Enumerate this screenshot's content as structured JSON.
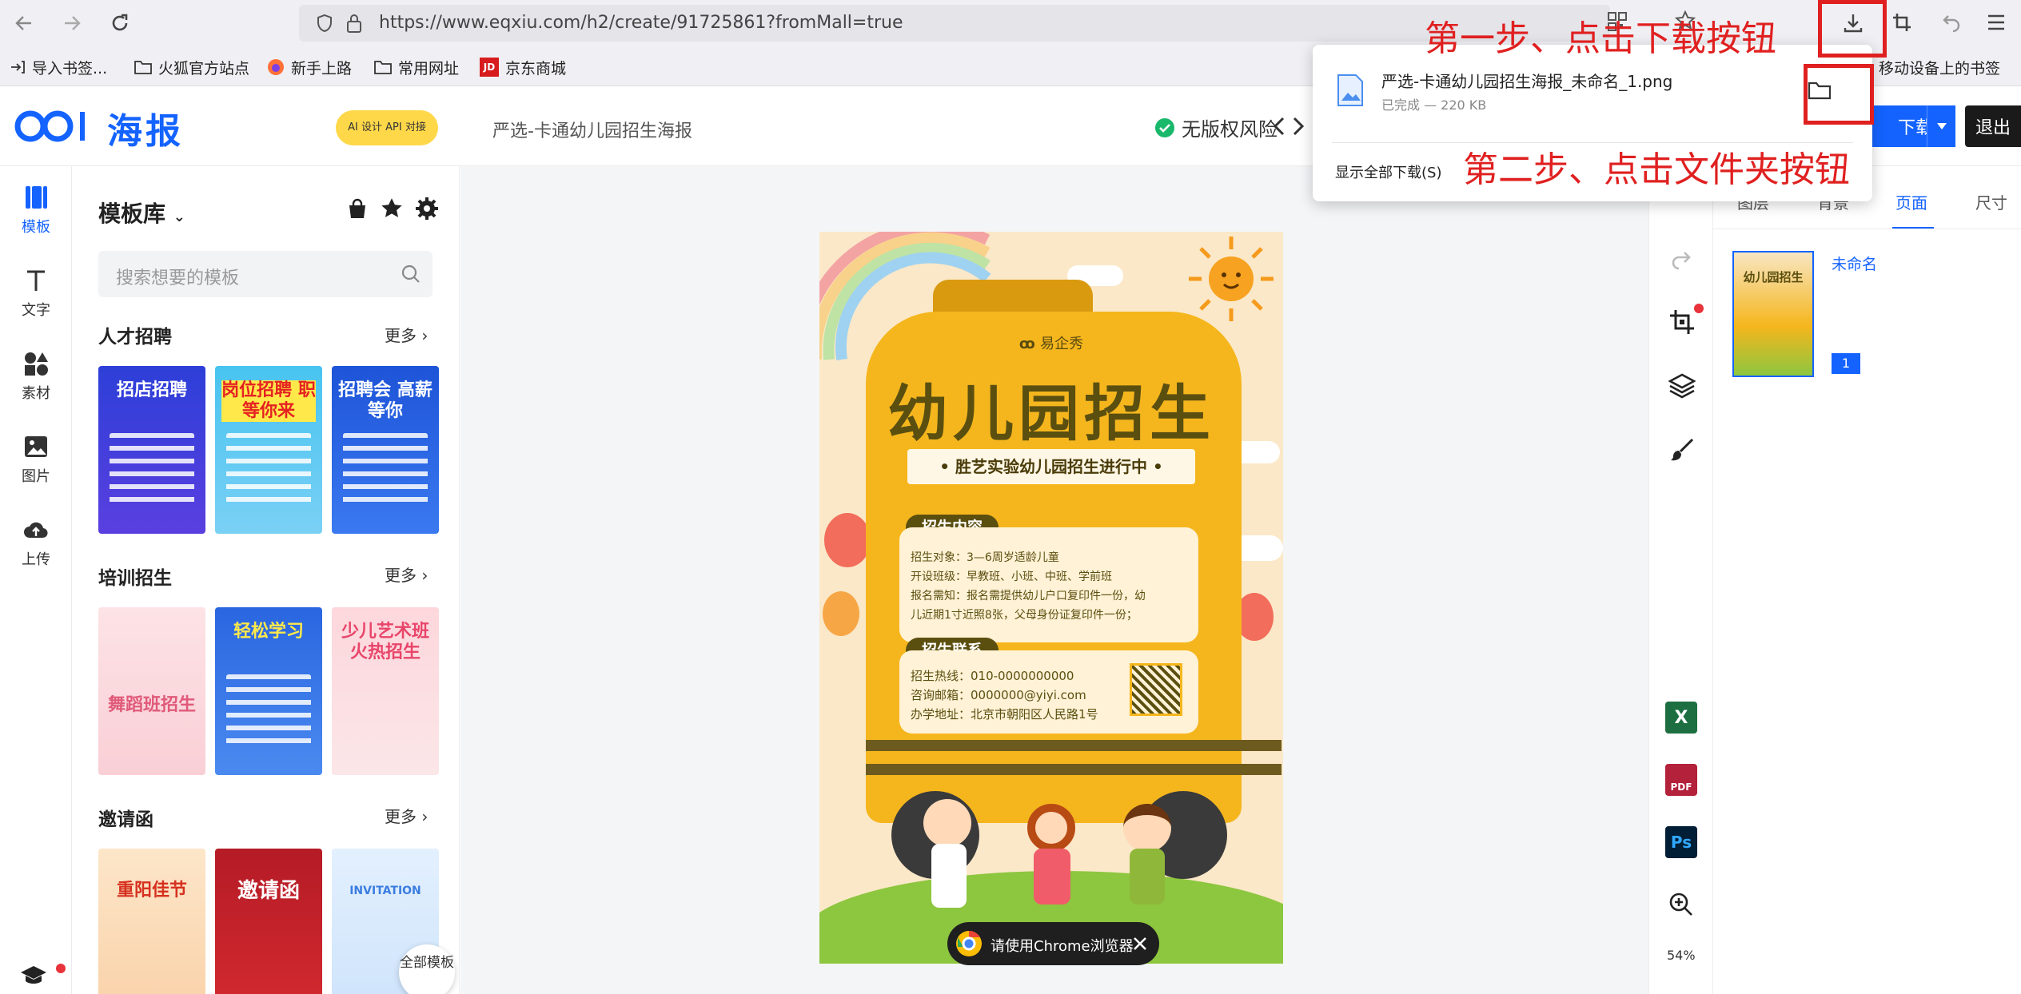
{
  "browser": {
    "url": "https://www.eqxiu.com/h2/create/91725861?fromMall=true",
    "bookmarks": [
      "导入书签...",
      "火狐官方站点",
      "新手上路",
      "常用网址",
      "京东商城"
    ],
    "mobile_bookmarks": "移动设备上的书签"
  },
  "header": {
    "logo": "海报",
    "api_badge": "AI 设计 API 对接",
    "doc_title": "严选-卡通幼儿园招生海报",
    "copyright_label": "无版权风险",
    "download_label": "下载",
    "exit_label": "退出"
  },
  "left_rail": [
    "模板",
    "文字",
    "素材",
    "图片",
    "上传"
  ],
  "template_panel": {
    "title": "模板库",
    "search_placeholder": "搜索想要的模板",
    "more_label": "更多",
    "all_templates": "全部模板",
    "sections": [
      {
        "title": "人才招聘",
        "thumbs": [
          "招店招聘",
          "岗位招聘 职等你来",
          "招聘会 高薪等你"
        ]
      },
      {
        "title": "培训招生",
        "thumbs": [
          "舞蹈班招生",
          "轻松学习",
          "少儿艺术班 火热招生"
        ]
      },
      {
        "title": "邀请函",
        "thumbs": [
          "重阳佳节",
          "邀请函",
          "INVITATION"
        ]
      }
    ]
  },
  "poster": {
    "brand": "易企秀",
    "headline": "幼儿园招生",
    "banner": "胜艺实验幼儿园招生进行中",
    "content_title": "招生内容",
    "content_lines": [
      "招生对象：3—6周岁适龄儿童",
      "开设班级：早教班、小班、中班、学前班",
      "报名需知：报名需提供幼儿户口复印件一份，幼",
      "儿近期1寸近照8张，父母身份证复印件一份；"
    ],
    "contact_title": "招生联系",
    "contact_lines": [
      "招生热线：010-0000000000",
      "咨询邮箱：0000000@yiyi.com",
      "办学地址：北京市朝阳区人民路1号"
    ]
  },
  "chrome_tip": "请使用Chrome浏览器",
  "right_panel": {
    "tabs": [
      "图层",
      "背景",
      "页面",
      "尺寸"
    ],
    "page_name": "未命名",
    "page_number": "1",
    "zoom": "54%"
  },
  "download_popup": {
    "file_name": "严选-卡通幼儿园招生海报_未命名_1.png",
    "status": "已完成 — 220 KB",
    "show_all": "显示全部下载(S)"
  },
  "annotations": {
    "step1": "第一步、点击下载按钮",
    "step2": "第二步、点击文件夹按钮"
  }
}
